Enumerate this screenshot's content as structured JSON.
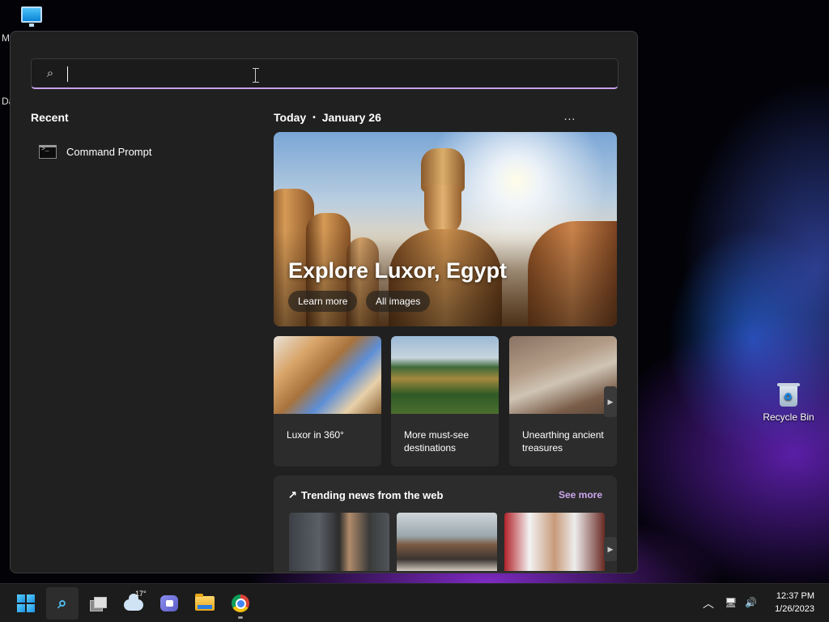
{
  "desktop": {
    "peek_labels": [
      "M",
      "Da"
    ],
    "recycle_bin": "Recycle Bin"
  },
  "search": {
    "placeholder": "",
    "value": ""
  },
  "recent": {
    "heading": "Recent",
    "items": [
      {
        "label": "Command Prompt",
        "icon": "command-prompt-icon"
      }
    ]
  },
  "today": {
    "label": "Today",
    "date": "January 26",
    "more": "..."
  },
  "hero": {
    "title": "Explore Luxor, Egypt",
    "learn_more": "Learn more",
    "all_images": "All images"
  },
  "cards": [
    {
      "caption": "Luxor in 360°"
    },
    {
      "caption": "More must-see destinations"
    },
    {
      "caption": "Unearthing ancient treasures"
    }
  ],
  "trending": {
    "heading": "Trending news from the web",
    "see_more": "See more"
  },
  "taskbar": {
    "weather_temp": "17°",
    "items": [
      "start",
      "search",
      "task-view",
      "widgets",
      "chat",
      "file-explorer",
      "chrome"
    ]
  },
  "clock": {
    "time": "12:37 PM",
    "date": "1/26/2023"
  },
  "colors": {
    "accent": "#c7a0e8",
    "panel": "#202020",
    "card": "#2c2c2c",
    "taskbar": "#1c1c1c"
  }
}
